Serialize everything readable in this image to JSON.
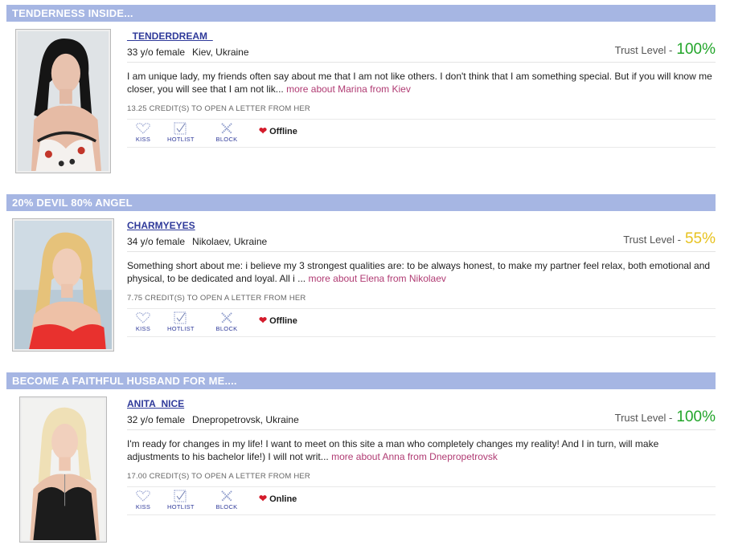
{
  "labels": {
    "trust_level": "Trust Level -",
    "kiss": "KISS",
    "hotlist": "HOTLIST",
    "block": "BLOCK"
  },
  "profiles": [
    {
      "headline": "TENDERNESS INSIDE...",
      "username": "_TENDERDREAM_",
      "age": "33 y/o female",
      "location": "Kiev, Ukraine",
      "trust_level": "100%",
      "trust_color": "#22a52a",
      "about": "I am unique lady, my friends often say about me that I am not like others. I don't think that I am something special. But if you will know me closer, you will see that I am not lik...",
      "more_link": "more about Marina from Kiev",
      "credits": "13.25 CREDIT(S) TO OPEN A LETTER FROM HER",
      "status": "Offline"
    },
    {
      "headline": "20% DEVIL 80% ANGEL",
      "username": "CHARMYEYES",
      "age": "34 y/o female",
      "location": "Nikolaev, Ukraine",
      "trust_level": "55%",
      "trust_color": "#e7c21f",
      "about": "Something short about me: i believe my 3 strongest qualities are: to be always honest, to make my partner feel relax, both emotional and physical, to be dedicated and loyal. All i ...",
      "more_link": "more about Elena from Nikolaev",
      "credits": "7.75 CREDIT(S) TO OPEN A LETTER FROM HER",
      "status": "Offline"
    },
    {
      "headline": "BECOME A FAITHFUL HUSBAND FOR ME....",
      "username": "ANITA_NICE",
      "age": "32 y/o female",
      "location": "Dnepropetrovsk, Ukraine",
      "trust_level": "100%",
      "trust_color": "#22a52a",
      "about": "I'm ready for changes in my life! I want to meet on this site a man who completely changes my reality! And I in turn, will make adjustments to his bachelor life!) I will not writ...",
      "more_link": "more about Anna from Dnepropetrovsk",
      "credits": "17.00 CREDIT(S) TO OPEN A LETTER FROM HER",
      "status": "Online"
    }
  ]
}
